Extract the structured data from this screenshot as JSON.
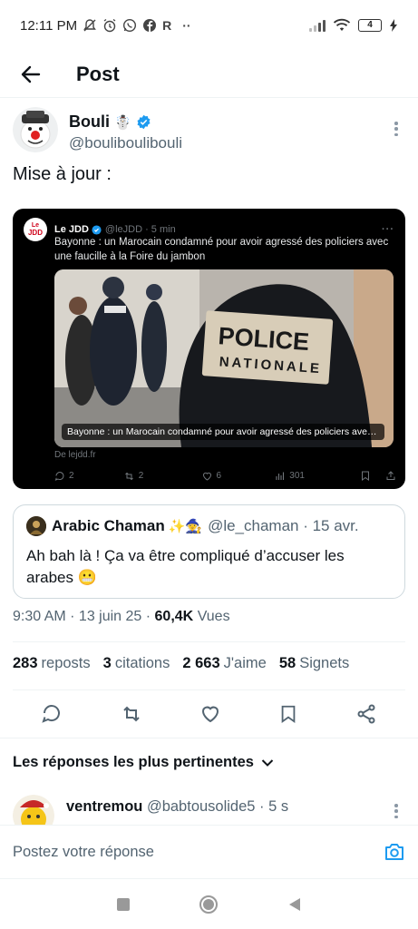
{
  "status_bar": {
    "time": "12:11 PM",
    "indicators": [
      "mute-icon",
      "alarm-icon",
      "whatsapp-icon",
      "facebook-icon",
      "r-icon"
    ],
    "extra": "··",
    "battery": "4"
  },
  "header": {
    "title": "Post"
  },
  "author": {
    "name": "Bouli",
    "emoji": "☃️",
    "handle": "@bouliboulibouli"
  },
  "tweet": {
    "text": "Mise à jour :"
  },
  "card": {
    "logo_top": "Le",
    "logo_bottom": "JDD",
    "name": "Le JDD",
    "meta": "@leJDD · 5 min",
    "text": "Bayonne : un Marocain condamné pour avoir agressé des policiers avec une faucille à la Foire du jambon",
    "photo_badge_line1": "POLICE",
    "photo_badge_line2": "NATIONALE",
    "caption": "Bayonne : un Marocain condamné pour avoir agressé des policiers avec u...",
    "source": "De lejdd.fr",
    "replies": "2",
    "reposts": "2",
    "likes": "6",
    "views": "301"
  },
  "quote": {
    "name": "Arabic Chaman",
    "emoji": "✨🧙",
    "meta": "@le_chaman · 15 avr.",
    "text": "Ah bah là ! Ça va être compliqué d’accuser les arabes 😬"
  },
  "meta": {
    "time_date": "9:30 AM · 13 juin 25 · ",
    "views_count": "60,4K",
    "views_label": "Vues"
  },
  "stats": {
    "reposts_count": "283",
    "reposts_label": "reposts",
    "quotes_count": "3",
    "quotes_label": "citations",
    "likes_count": "2 663",
    "likes_label": "J'aime",
    "bookmarks_count": "58",
    "bookmarks_label": "Signets"
  },
  "best_replies": "Les réponses les plus pertinentes",
  "reply": {
    "name": "ventremou",
    "meta": "@babtousolide5 · 5 s"
  },
  "composer": {
    "placeholder": "Postez votre réponse"
  },
  "colors": {
    "accent": "#1d9bf0",
    "secondary_text": "#536471",
    "border": "#cfd9de"
  }
}
